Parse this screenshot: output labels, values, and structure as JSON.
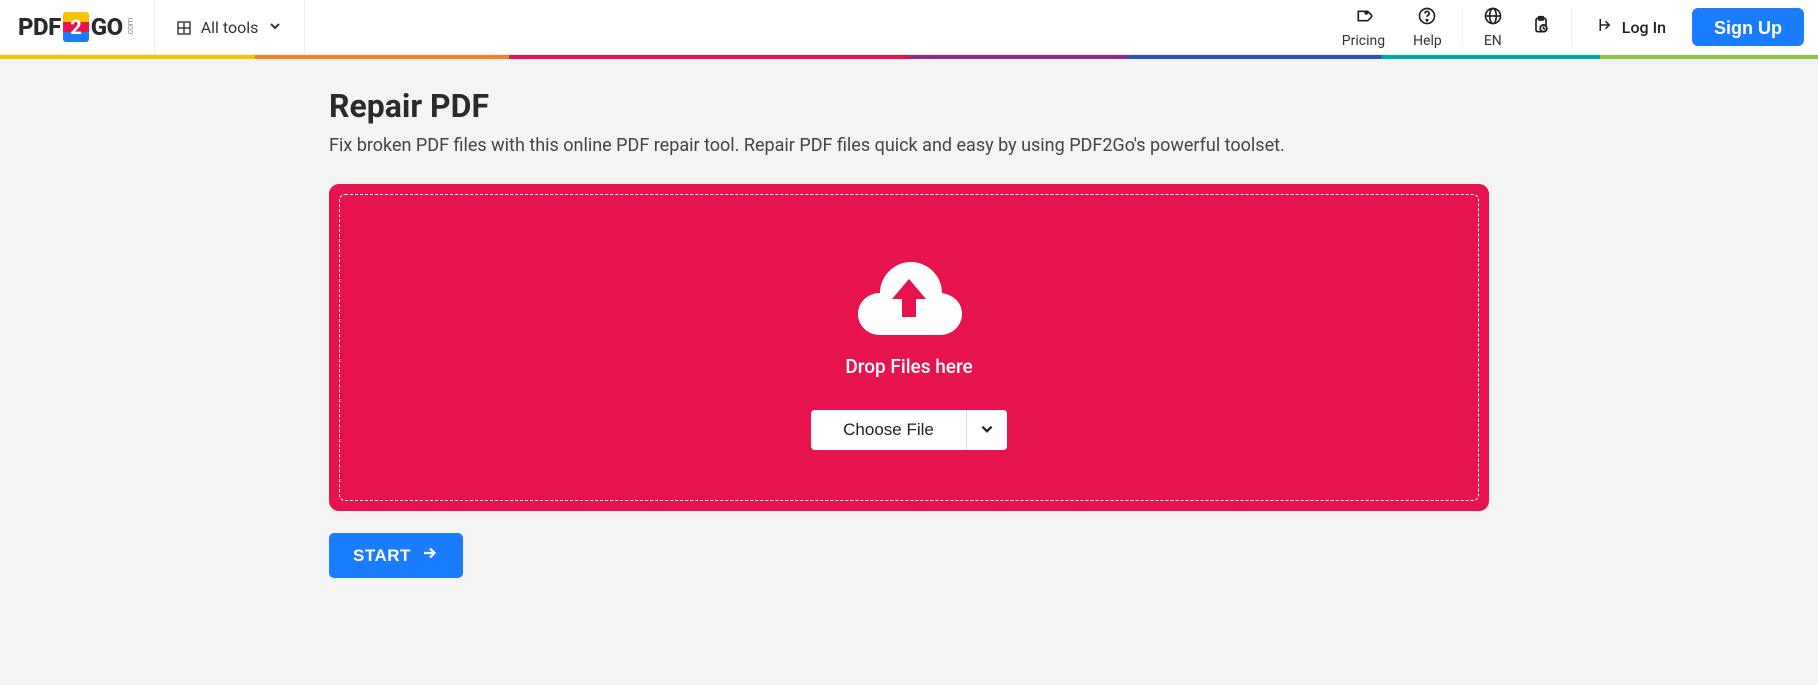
{
  "header": {
    "logo": {
      "p1": "PDF",
      "p2": "2",
      "p3": "GO",
      "dot": ".com"
    },
    "all_tools_label": "All tools",
    "nav": {
      "pricing": "Pricing",
      "help": "Help",
      "language": "EN"
    },
    "login_label": "Log In",
    "signup_label": "Sign Up"
  },
  "main": {
    "title": "Repair PDF",
    "subtitle": "Fix broken PDF files with this online PDF repair tool. Repair PDF files quick and easy by using PDF2Go's powerful toolset.",
    "drop_text": "Drop Files here",
    "choose_file_label": "Choose File",
    "start_label": "START"
  },
  "colors": {
    "accent_pink": "#e6134f",
    "accent_blue": "#1a7cff"
  }
}
